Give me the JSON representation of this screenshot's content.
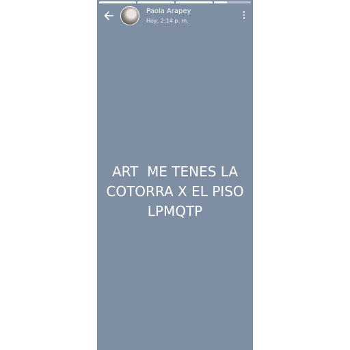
{
  "story": {
    "background_color": "#7f8fa3",
    "progress_segments": [
      1,
      1,
      1,
      0.35
    ],
    "header": {
      "back_icon": "arrow-left-icon",
      "author_name": "Paola Arapey",
      "timestamp": "Hoy, 2:14 p. m.",
      "menu_icon": "more-vert-icon"
    },
    "message_lines": [
      "ART  ME TENES LA",
      "COTORRA X EL PISO",
      "LPMQTP"
    ]
  }
}
